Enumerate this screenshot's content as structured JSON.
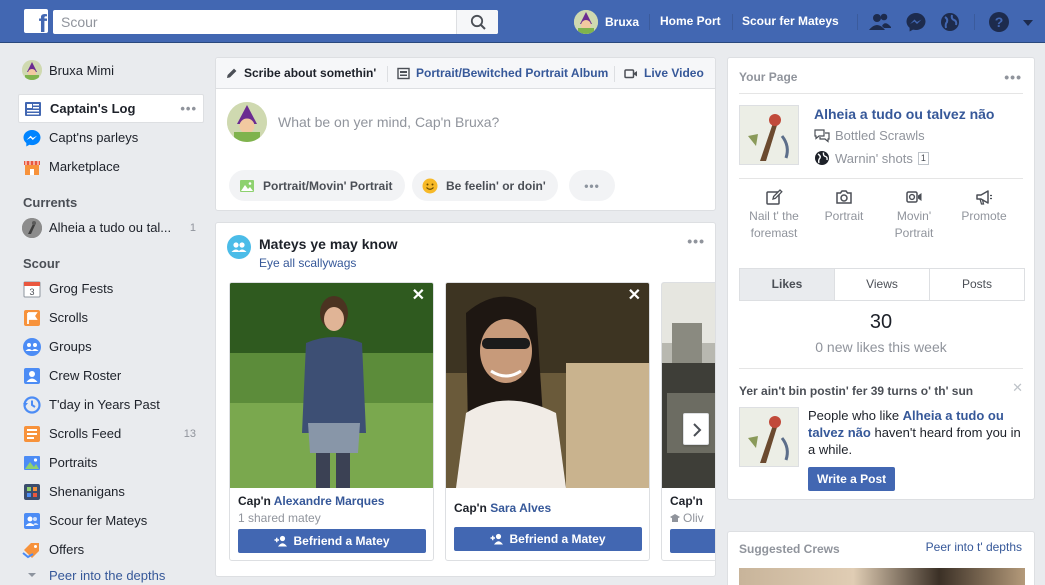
{
  "topbar": {
    "logo": "f",
    "search_placeholder": "Scour",
    "profile_name": "Bruxa",
    "home_label": "Home Port",
    "find_friends_label": "Scour fer Mateys"
  },
  "left_nav": {
    "profile_name": "Bruxa Mimi",
    "items": [
      {
        "label": "Captain's Log",
        "icon": "news-feed-icon"
      },
      {
        "label": "Capt'ns parleys",
        "icon": "messenger-icon"
      },
      {
        "label": "Marketplace",
        "icon": "marketplace-icon"
      }
    ],
    "currents_heading": "Currents",
    "currents": [
      {
        "label": "Alheia a tudo ou tal...",
        "count": "1"
      }
    ],
    "scour_heading": "Scour",
    "explore": [
      {
        "label": "Grog Fests",
        "icon": "calendar-icon",
        "count": ""
      },
      {
        "label": "Scrolls",
        "icon": "pages-flag-icon",
        "count": ""
      },
      {
        "label": "Groups",
        "icon": "groups-icon",
        "count": ""
      },
      {
        "label": "Crew Roster",
        "icon": "friend-lists-icon",
        "count": ""
      },
      {
        "label": "T'day in Years Past",
        "icon": "memories-icon",
        "count": ""
      },
      {
        "label": "Scrolls Feed",
        "icon": "pages-feed-icon",
        "count": "13"
      },
      {
        "label": "Portraits",
        "icon": "photos-icon",
        "count": ""
      },
      {
        "label": "Shenanigans",
        "icon": "games-icon",
        "count": ""
      },
      {
        "label": "Scour fer Mateys",
        "icon": "find-friends-icon",
        "count": ""
      },
      {
        "label": "Offers",
        "icon": "offers-icon",
        "count": ""
      }
    ],
    "see_more": "Peer into the depths"
  },
  "composer": {
    "tabs": [
      "Scribe about somethin'",
      "Portrait/Bewitched Portrait Album",
      "Live Video"
    ],
    "placeholder": "What be on yer mind, Cap'n Bruxa?",
    "pill_photo": "Portrait/Movin' Portrait",
    "pill_feeling": "Be feelin' or doin'"
  },
  "pymk": {
    "title": "Mateys ye may know",
    "see_all": "Eye all scallywags",
    "people": [
      {
        "prefix": "Cap'n",
        "name": "Alexandre Marques",
        "meta": "1 shared matey",
        "button": "Befriend a Matey"
      },
      {
        "prefix": "Cap'n",
        "name": "Sara Alves",
        "meta": "",
        "button": "Befriend a Matey"
      },
      {
        "prefix": "Cap'n",
        "name": "",
        "meta": "Oliv",
        "button": ""
      }
    ]
  },
  "your_page": {
    "heading": "Your Page",
    "page_name": "Alheia a tudo ou talvez não",
    "messages": "Bottled Scrawls",
    "notifications": "Warnin' shots",
    "notifications_count": "1",
    "actions": [
      {
        "label": "Nail t' the foremast",
        "icon": "pencil-square-icon"
      },
      {
        "label": "Portrait",
        "icon": "camera-icon"
      },
      {
        "label": "Movin' Portrait",
        "icon": "video-camera-icon"
      },
      {
        "label": "Promote",
        "icon": "megaphone-icon"
      }
    ],
    "stat_tabs": [
      "Likes",
      "Views",
      "Posts"
    ],
    "likes_total": "30",
    "likes_week": "0 new likes this week",
    "reminder_title": "Yer ain't bin postin' fer 39 turns o' th' sun",
    "reminder_text_before": "People who like ",
    "reminder_text_page": "Alheia a tudo ou talvez não",
    "reminder_text_after": " haven't heard from you in a while.",
    "write_post": "Write a Post"
  },
  "suggested": {
    "heading": "Suggested Crews",
    "see_more": "Peer into t' depths"
  },
  "colors": {
    "brand": "#4267b2",
    "link": "#365899",
    "background": "#e9ebee"
  }
}
